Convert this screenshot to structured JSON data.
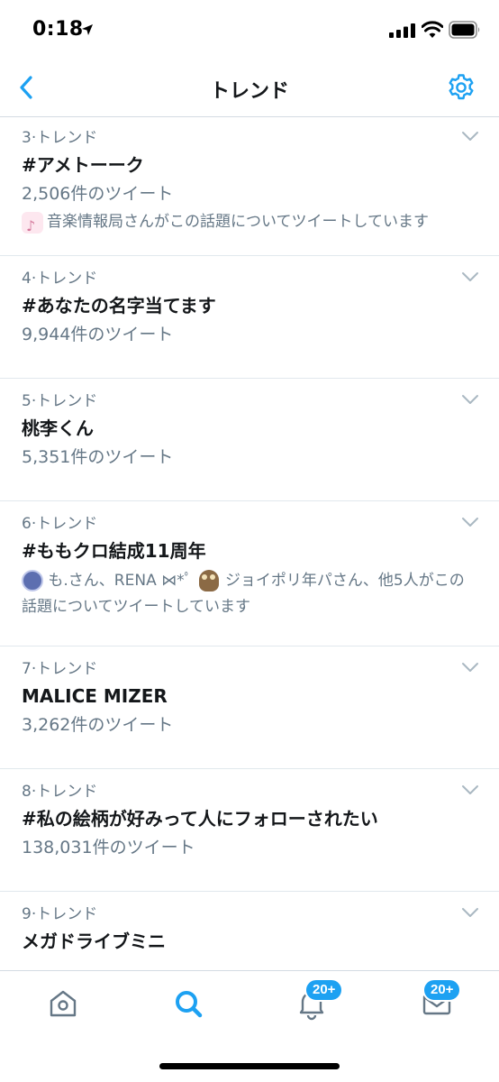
{
  "status": {
    "time": "0:18"
  },
  "header": {
    "title": "トレンド",
    "back_icon": "chevron-left-icon",
    "settings_icon": "gear-icon"
  },
  "trends": [
    {
      "rank": "3·トレンド",
      "name": "#アメトーーク",
      "count": "2,506件のツイート",
      "context": "音楽情報局さんがこの話題についてツイートしています"
    },
    {
      "rank": "4·トレンド",
      "name": "#あなたの名字当てます",
      "count": "9,944件のツイート"
    },
    {
      "rank": "5·トレンド",
      "name": "桃李くん",
      "count": "5,351件のツイート"
    },
    {
      "rank": "6·トレンド",
      "name": "#ももクロ結成11周年",
      "context_pre": "も.さん、RENA ⋈*ﾟ",
      "context_post": "ジョイポリ年パさん、他5人がこの話題についてツイートしています"
    },
    {
      "rank": "7·トレンド",
      "name": "MALICE MIZER",
      "count": "3,262件のツイート"
    },
    {
      "rank": "8·トレンド",
      "name": "#私の絵柄が好みって人にフォローされたい",
      "count": "138,031件のツイート"
    },
    {
      "rank": "9·トレンド",
      "name": "メガドライブミニ"
    }
  ],
  "tabbar": {
    "notifications_badge": "20+",
    "messages_badge": "20+"
  },
  "colors": {
    "accent": "#1da1f2",
    "secondary_text": "#657786",
    "primary_text": "#14171a"
  }
}
